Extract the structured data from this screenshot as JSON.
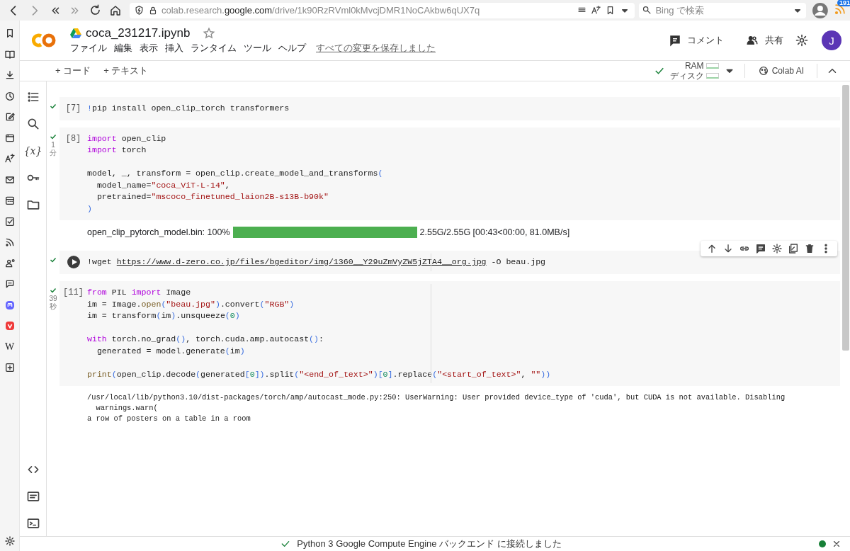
{
  "browser": {
    "url_host_prefix": "colab.research.",
    "url_domain": "google.com",
    "url_path": "/drive/1k90RzRVml0kMvcjDMR1NoCAkbw6qUX7q",
    "search_placeholder": "Bing で検索",
    "feed_badge": "191",
    "sidebar_letter": "W"
  },
  "notebook": {
    "title": "coca_231217.ipynb",
    "starred": false,
    "menu": [
      "ファイル",
      "編集",
      "表示",
      "挿入",
      "ランタイム",
      "ツール",
      "ヘルプ"
    ],
    "save_status": "すべての変更を保存しました",
    "comment_button": "コメント",
    "share_button": "共有",
    "avatar": "J"
  },
  "toolbar": {
    "add_code": "+ コード",
    "add_text": "+ テキスト",
    "connected": true,
    "ram_label": "RAM",
    "disk_label": "ディスク",
    "colab_ai": "Colab AI"
  },
  "rail": {
    "variables_label": "{x}"
  },
  "cells": [
    {
      "count": "[7]",
      "done": true,
      "hovered": false,
      "ruler": false,
      "blocks": [
        [
          [
            {
              "text": "!",
              "kind": "paren"
            },
            {
              "text": "pip install open_clip_torch transformers",
              "kind": "plain"
            }
          ]
        ]
      ]
    },
    {
      "count": "[8]",
      "done": true,
      "duration": "1 分",
      "hovered": false,
      "ruler": false,
      "blocks": [
        [
          [
            {
              "text": "import",
              "kind": "kw"
            },
            {
              "text": " open_clip",
              "kind": "plain"
            }
          ],
          [
            {
              "text": "import",
              "kind": "kw"
            },
            {
              "text": " torch",
              "kind": "plain"
            }
          ]
        ],
        [
          [
            {
              "text": "model, _, transform = open_clip.create_model_and_transforms",
              "kind": "plain"
            },
            {
              "text": "(",
              "kind": "paren"
            }
          ],
          [
            {
              "text": "  model_name=",
              "kind": "plain"
            },
            {
              "text": "\"coca_ViT-L-14\"",
              "kind": "str"
            },
            {
              "text": ",",
              "kind": "plain"
            }
          ],
          [
            {
              "text": "  pretrained=",
              "kind": "plain"
            },
            {
              "text": "\"mscoco_finetuned_laion2B-s13B-b90k\"",
              "kind": "str"
            }
          ],
          [
            {
              "text": ")",
              "kind": "paren"
            }
          ]
        ]
      ],
      "output": {
        "kind": "progress",
        "label": "open_clip_pytorch_model.bin: 100%",
        "level": 1,
        "reading": "2.55G/2.55G [00:43<00:00, 81.0MB/s]"
      }
    },
    {
      "done": true,
      "hovered": true,
      "ruler": true,
      "blocks": [
        [
          [
            {
              "text": "!wget ",
              "kind": "plain"
            },
            {
              "text": "https://www.d-zero.co.jp/files/bgeditor/img/1360__Y29uZmVyZW5jZTA4__org.jpg",
              "kind": "link"
            },
            {
              "text": " -O beau.jpg",
              "kind": "plain"
            }
          ]
        ]
      ]
    },
    {
      "count": "[11]",
      "done": true,
      "duration": "39 秒",
      "hovered": false,
      "ruler": true,
      "blocks": [
        [
          [
            {
              "text": "from",
              "kind": "kw"
            },
            {
              "text": " PIL ",
              "kind": "plain"
            },
            {
              "text": "import",
              "kind": "kw"
            },
            {
              "text": " Image",
              "kind": "plain"
            }
          ],
          [
            {
              "text": "im = Image.",
              "kind": "plain"
            },
            {
              "text": "open",
              "kind": "fn"
            },
            {
              "text": "(",
              "kind": "paren"
            },
            {
              "text": "\"beau.jpg\"",
              "kind": "str"
            },
            {
              "text": ")",
              "kind": "paren"
            },
            {
              "text": ".convert",
              "kind": "plain"
            },
            {
              "text": "(",
              "kind": "paren"
            },
            {
              "text": "\"RGB\"",
              "kind": "str"
            },
            {
              "text": ")",
              "kind": "paren"
            }
          ],
          [
            {
              "text": "im = transform",
              "kind": "plain"
            },
            {
              "text": "(",
              "kind": "paren"
            },
            {
              "text": "im",
              "kind": "plain"
            },
            {
              "text": ")",
              "kind": "paren"
            },
            {
              "text": ".unsqueeze",
              "kind": "plain"
            },
            {
              "text": "(",
              "kind": "paren"
            },
            {
              "text": "0",
              "kind": "num"
            },
            {
              "text": ")",
              "kind": "paren"
            }
          ]
        ],
        [
          [
            {
              "text": "with",
              "kind": "kw"
            },
            {
              "text": " torch.no_grad",
              "kind": "plain"
            },
            {
              "text": "()",
              "kind": "paren"
            },
            {
              "text": ", torch.cuda.amp.autocast",
              "kind": "plain"
            },
            {
              "text": "()",
              "kind": "paren"
            },
            {
              "text": ":",
              "kind": "plain"
            }
          ],
          [
            {
              "text": "  generated = model.generate",
              "kind": "plain"
            },
            {
              "text": "(",
              "kind": "paren"
            },
            {
              "text": "im",
              "kind": "plain"
            },
            {
              "text": ")",
              "kind": "paren"
            }
          ]
        ],
        [
          [
            {
              "text": "print",
              "kind": "fn"
            },
            {
              "text": "(",
              "kind": "paren"
            },
            {
              "text": "open_clip.decode",
              "kind": "plain"
            },
            {
              "text": "(",
              "kind": "paren"
            },
            {
              "text": "generated",
              "kind": "plain"
            },
            {
              "text": "[",
              "kind": "paren"
            },
            {
              "text": "0",
              "kind": "num"
            },
            {
              "text": "]",
              "kind": "paren"
            },
            {
              "text": ")",
              "kind": "paren"
            },
            {
              "text": ".split",
              "kind": "plain"
            },
            {
              "text": "(",
              "kind": "paren"
            },
            {
              "text": "\"<end_of_text>\"",
              "kind": "str"
            },
            {
              "text": ")",
              "kind": "paren"
            },
            {
              "text": "[",
              "kind": "paren"
            },
            {
              "text": "0",
              "kind": "num"
            },
            {
              "text": "]",
              "kind": "paren"
            },
            {
              "text": ".replace",
              "kind": "plain"
            },
            {
              "text": "(",
              "kind": "paren"
            },
            {
              "text": "\"<start_of_text>\"",
              "kind": "str"
            },
            {
              "text": ", ",
              "kind": "plain"
            },
            {
              "text": "\"\"",
              "kind": "str"
            },
            {
              "text": "))",
              "kind": "paren"
            }
          ]
        ]
      ],
      "output": {
        "kind": "text",
        "lines": [
          "/usr/local/lib/python3.10/dist-packages/torch/amp/autocast_mode.py:250: UserWarning: User provided device_type of 'cuda', but CUDA is not available. Disabling",
          "  warnings.warn(",
          "a row of posters on a table in a room"
        ]
      }
    }
  ],
  "status_bar": {
    "connected": true,
    "message": "Python 3 Google Compute Engine バックエンド に接続しました"
  }
}
